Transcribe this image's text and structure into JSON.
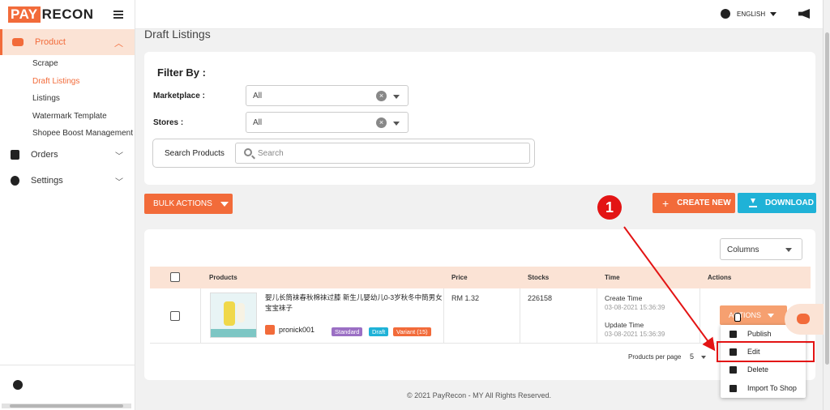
{
  "brand": {
    "part1": "PAY",
    "part2": "RECON"
  },
  "sidebar": {
    "product_label": "Product",
    "subitems": [
      "Scrape",
      "Draft Listings",
      "Listings",
      "Watermark Template",
      "Shopee Boost Management"
    ],
    "orders_label": "Orders",
    "settings_label": "Settings"
  },
  "topbar": {
    "language": "ENGLISH"
  },
  "page_title": "Draft Listings",
  "filter": {
    "title": "Filter By :",
    "marketplace_label": "Marketplace :",
    "marketplace_value": "All",
    "stores_label": "Stores :",
    "stores_value": "All",
    "search_label": "Search Products",
    "search_placeholder": "Search"
  },
  "buttons": {
    "bulk": "BULK ACTIONS",
    "create": "CREATE NEW",
    "download": "DOWNLOAD",
    "actions": "ACTIONS"
  },
  "table": {
    "columns_select": "Columns",
    "headers": {
      "products": "Products",
      "price": "Price",
      "stocks": "Stocks",
      "time": "Time",
      "actions": "Actions"
    },
    "row": {
      "name": "婴儿长筒袜春秋棉袜过膝 新生儿婴幼儿0-3岁秋冬中筒男女宝宝袜子",
      "store": "pronick001",
      "badges": [
        "Standard",
        "Draft",
        "Variant (15)"
      ],
      "price": "RM 1.32",
      "stocks": "226158",
      "create_label": "Create Time",
      "create_value": "03-08-2021 15:36:39",
      "update_label": "Update Time",
      "update_value": "03-08-2021 15:36:39"
    },
    "pager_label": "Products per page",
    "pager_value": "5"
  },
  "menu": [
    "Publish",
    "Edit",
    "Delete",
    "Import To Shop"
  ],
  "footer": "© 2021 PayRecon - MY All Rights Reserved.",
  "annotation": {
    "step": "1"
  },
  "colors": {
    "accent": "#f26b3a",
    "accent_light": "#fbe3d5",
    "download": "#1fb2d7",
    "annotation": "#e31414",
    "badge_standard": "#9b6fc4",
    "badge_draft": "#1fb2d7",
    "badge_variant": "#f26b3a"
  }
}
